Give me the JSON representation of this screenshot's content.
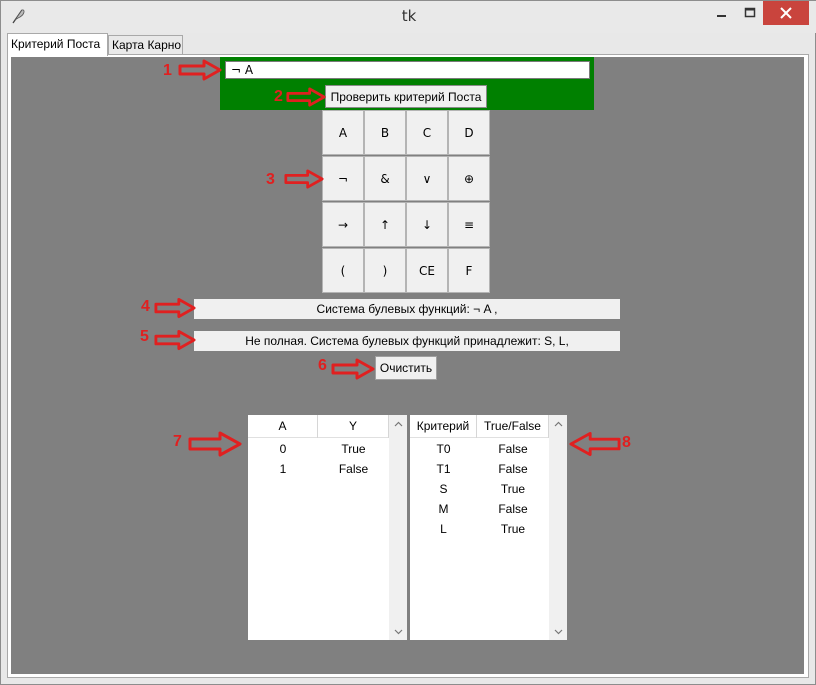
{
  "window": {
    "title": "tk"
  },
  "tabs": [
    {
      "label": "Критерий Поста",
      "active": true
    },
    {
      "label": "Карта Карно",
      "active": false
    }
  ],
  "formula": {
    "value": "¬  A"
  },
  "check_button": "Проверить критерий Поста",
  "keypad": [
    "A",
    "B",
    "C",
    "D",
    "¬",
    "&",
    "∨",
    "⊕",
    "→",
    "↑",
    "↓",
    "≡",
    "(",
    ")",
    "CE",
    "F"
  ],
  "system_label": "Система булевых функций:   ¬   A ,",
  "result_label": "Не полная. Система булевых функций принадлежит: S, L,",
  "clear_button": "Очистить",
  "truth_table": {
    "columns": [
      "A",
      "Y"
    ],
    "rows": [
      [
        "0",
        "True"
      ],
      [
        "1",
        "False"
      ]
    ]
  },
  "criteria_table": {
    "columns": [
      "Критерий",
      "True/False"
    ],
    "rows": [
      [
        "T0",
        "False"
      ],
      [
        "T1",
        "False"
      ],
      [
        "S",
        "True"
      ],
      [
        "M",
        "False"
      ],
      [
        "L",
        "True"
      ]
    ]
  },
  "annotations": [
    "1",
    "2",
    "3",
    "4",
    "5",
    "6",
    "7",
    "8"
  ],
  "colors": {
    "panel": "#808080",
    "formula_box": "#008000",
    "annotation": "#e02020",
    "close": "#c9443d"
  }
}
